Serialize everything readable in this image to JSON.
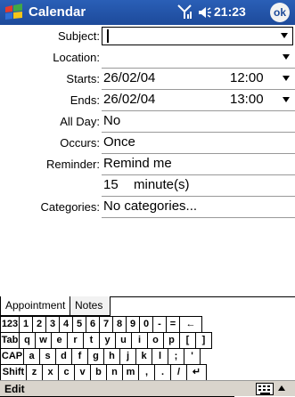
{
  "titlebar": {
    "title": "Calendar",
    "time": "21:23",
    "ok": "ok"
  },
  "form": {
    "subject": {
      "label": "Subject:",
      "value": ""
    },
    "location": {
      "label": "Location:",
      "value": ""
    },
    "starts": {
      "label": "Starts:",
      "date": "26/02/04",
      "time": "12:00"
    },
    "ends": {
      "label": "Ends:",
      "date": "26/02/04",
      "time": "13:00"
    },
    "allday": {
      "label": "All Day:",
      "value": "No"
    },
    "occurs": {
      "label": "Occurs:",
      "value": "Once"
    },
    "reminder": {
      "label": "Reminder:",
      "value": "Remind me"
    },
    "reminder_detail": {
      "number": "15",
      "unit": "minute(s)"
    },
    "categories": {
      "label": "Categories:",
      "value": "No categories..."
    }
  },
  "tabs": [
    {
      "label": "Appointment",
      "active": true
    },
    {
      "label": "Notes",
      "active": false
    }
  ],
  "keyboard": {
    "rows": [
      [
        "123",
        "1",
        "2",
        "3",
        "4",
        "5",
        "6",
        "7",
        "8",
        "9",
        "0",
        "-",
        "=",
        "←"
      ],
      [
        "Tab",
        "q",
        "w",
        "e",
        "r",
        "t",
        "y",
        "u",
        "i",
        "o",
        "p",
        "[",
        "]"
      ],
      [
        "CAP",
        "a",
        "s",
        "d",
        "f",
        "g",
        "h",
        "j",
        "k",
        "l",
        ";",
        "'"
      ],
      [
        "Shift",
        "z",
        "x",
        "c",
        "v",
        "b",
        "n",
        "m",
        ",",
        ".",
        "/",
        "↵"
      ],
      [
        "Ctl",
        "áü",
        "`",
        "\\",
        "",
        "↓",
        "↑",
        "←",
        "→"
      ]
    ]
  },
  "menubar": {
    "edit": "Edit"
  },
  "colors": {
    "titlebar": "#1d4a9a",
    "menubar": "#d9d4cc"
  },
  "icons": [
    "windows-start-icon",
    "signal-icon",
    "speaker-icon",
    "keyboard-icon",
    "sip-arrow-icon"
  ]
}
